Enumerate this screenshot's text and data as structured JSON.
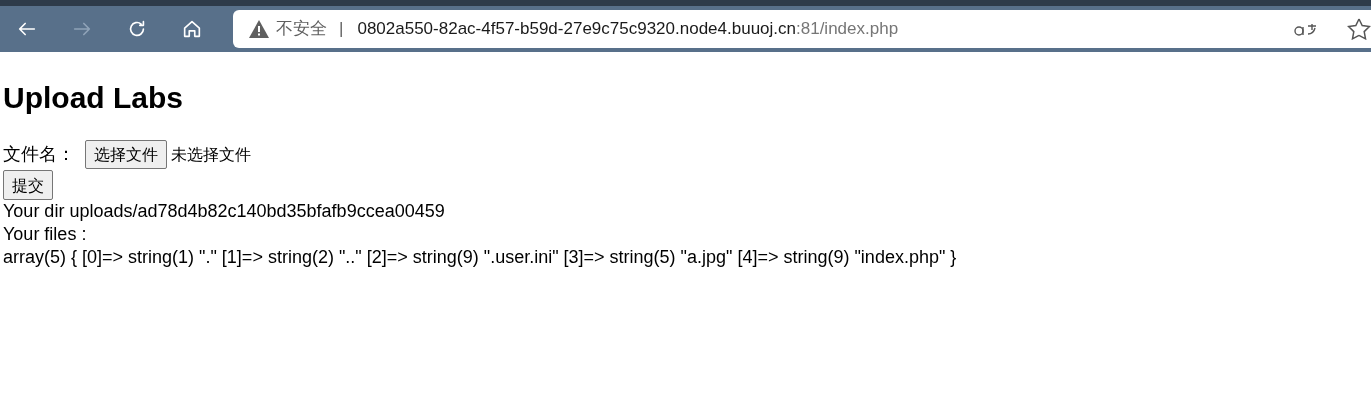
{
  "browser": {
    "nav_buttons": [
      {
        "kind": "back",
        "disabled": false
      },
      {
        "kind": "forward",
        "disabled": true
      },
      {
        "kind": "reload",
        "disabled": false
      },
      {
        "kind": "home",
        "disabled": false
      }
    ],
    "address_bar": {
      "security": "不安全",
      "separator": "|",
      "host": "0802a550-82ac-4f57-b59d-27e9c75c9320.node4.buuoj.cn",
      "path": ":81/index.php"
    }
  },
  "page": {
    "heading": "Upload Labs",
    "file_label": "文件名：",
    "file_button": "选择文件",
    "file_status": "未选择文件",
    "submit": "提交",
    "lines": [
      "Your dir uploads/ad78d4b82c140bd35bfafb9ccea00459",
      "Your files :",
      "array(5) { [0]=> string(1) \".\" [1]=> string(2) \"..\" [2]=> string(9) \".user.ini\" [3]=> string(5) \"a.jpg\" [4]=> string(9) \"index.php\" }"
    ]
  }
}
